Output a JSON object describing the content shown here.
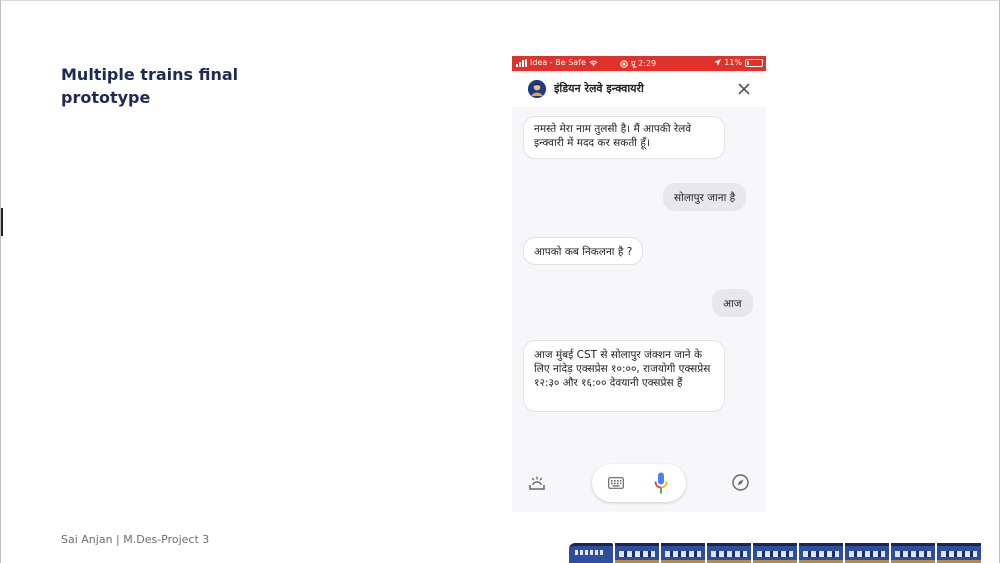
{
  "slide": {
    "title_line1": "Multiple trains final",
    "title_line2": "prototype",
    "footer": "Sai Anjan | M.Des-Project 3"
  },
  "status_bar": {
    "carrier": "Idea - Be Safe",
    "time": "प्रू 2:29",
    "battery": "11%",
    "color": "#e0322b"
  },
  "chat": {
    "bot_name": "इंडियन रेलवे इन्क्वायरी",
    "messages": [
      {
        "from": "bot",
        "text": "नमस्ते मेरा नाम तुलसी है। मैं आपकी रेलवे इन्क्वारी में मदद कर सकती हूँ।"
      },
      {
        "from": "user",
        "text": "सोलापुर जाना है"
      },
      {
        "from": "bot",
        "text": "आपको कब निकलना है ?"
      },
      {
        "from": "user",
        "text": "आज"
      },
      {
        "from": "bot",
        "text": "आज मुंबई CST से सोलापुर जंक्शन जाने के लिए नांदेड़ एक्सप्रेस १०:००, राजयोगी एक्सप्रेस १२:३० और १६:०० देवयानी एक्सप्रेस हैं"
      }
    ]
  },
  "icons": {
    "close": "close-icon",
    "lens": "lens-icon",
    "keyboard": "keyboard-icon",
    "mic": "mic-icon",
    "explore": "compass-icon"
  },
  "colors": {
    "title": "#1e2a52",
    "train_body": "#2f4f9e",
    "mic_blue": "#4285f4",
    "mic_red": "#ea4335",
    "mic_yellow": "#fbbc05",
    "mic_green": "#34a853"
  }
}
